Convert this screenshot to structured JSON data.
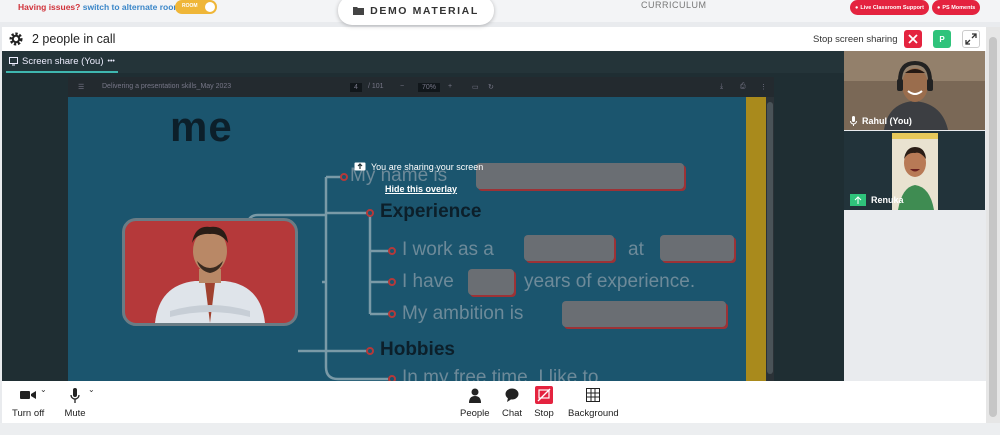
{
  "topbar": {
    "issues_text": "Having issues?",
    "switch_text": "switch to alternate room",
    "room_toggle_label": "ROOM",
    "demo_material": "DEMO MATERIAL",
    "curriculum": "CURRICULUM",
    "live_support": "Live Classroom Support",
    "ps_moments": "PS Moments"
  },
  "call": {
    "people_count": "2 people in call",
    "stop_screen_sharing": "Stop screen sharing",
    "participant_badge": "P"
  },
  "share": {
    "tab_label": "Screen share (You)",
    "tab_more": "•••",
    "overlay_message": "You are sharing your screen",
    "hide_overlay": "Hide this overlay"
  },
  "pdf": {
    "doc_title": "Delivering a presentation skills_May 2023",
    "page": "4",
    "total_pages": "/ 101",
    "zoom": "70%"
  },
  "slide": {
    "title": "me",
    "line1": "My name is",
    "heading1": "Experience",
    "line2a": "I work as a",
    "line2b": "at",
    "line3a": "I have",
    "line3b": "years of experience.",
    "line4": "My ambition is",
    "heading2": "Hobbies",
    "line5": "In my free time, I like to"
  },
  "participants": [
    {
      "name": "Rahul (You)"
    },
    {
      "name": "Renuka"
    }
  ],
  "controls": {
    "camera": "Turn off",
    "mic": "Mute",
    "people": "People",
    "chat": "Chat",
    "stop": "Stop",
    "background": "Background"
  },
  "colors": {
    "accent_red": "#e4233f",
    "accent_green": "#2fc37b",
    "toggle_yellow": "#efb638",
    "slide_blue": "#1b556e"
  }
}
